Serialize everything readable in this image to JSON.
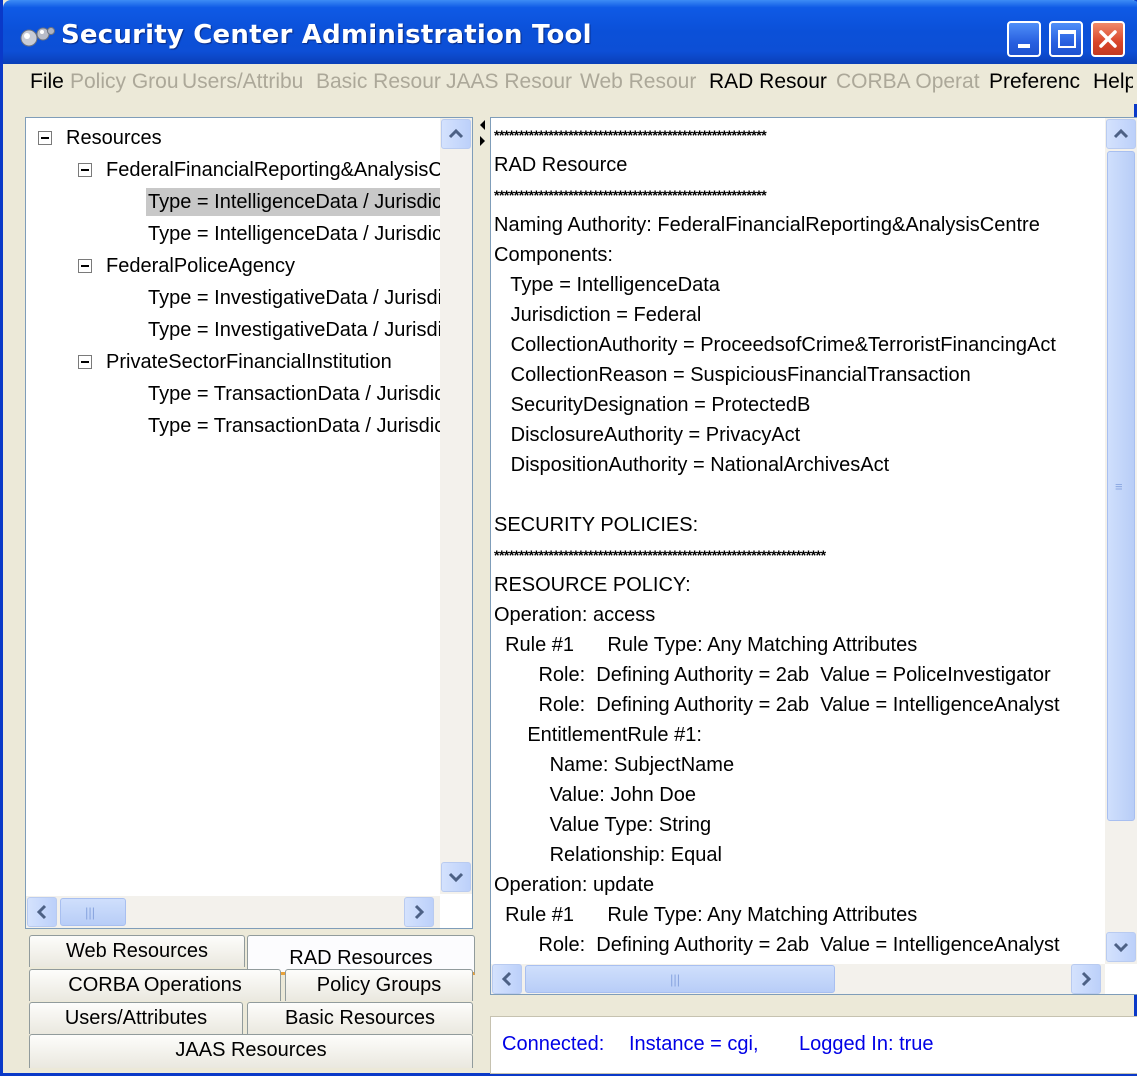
{
  "window": {
    "title": "Security Center Administration Tool"
  },
  "menubar": {
    "items": [
      {
        "label": "File",
        "enabled": true
      },
      {
        "label": "Policy Grou",
        "enabled": false
      },
      {
        "label": "Users/Attribu",
        "enabled": false
      },
      {
        "label": "Basic Resour",
        "enabled": false
      },
      {
        "label": "JAAS Resour",
        "enabled": false
      },
      {
        "label": "Web Resour",
        "enabled": false
      },
      {
        "label": "RAD Resour",
        "enabled": true
      },
      {
        "label": "CORBA Operat",
        "enabled": false
      },
      {
        "label": "Preferenc",
        "enabled": true
      },
      {
        "label": "Help",
        "enabled": true
      }
    ]
  },
  "tree": {
    "root": "Resources",
    "groups": [
      {
        "label": "FederalFinancialReporting&AnalysisCentre",
        "children": [
          {
            "label": "Type = IntelligenceData   /   Jurisdiction = Federal",
            "selected": true
          },
          {
            "label": "Type = IntelligenceData   /   Jurisdiction = Federal",
            "selected": false
          }
        ]
      },
      {
        "label": "FederalPoliceAgency",
        "children": [
          {
            "label": "Type = InvestigativeData   /   Jurisdiction = Federal",
            "selected": false
          },
          {
            "label": "Type = InvestigativeData   /   Jurisdiction = Federal",
            "selected": false
          }
        ]
      },
      {
        "label": "PrivateSectorFinancialInstitution",
        "children": [
          {
            "label": "Type = TransactionData   /   Jurisdiction = Federal",
            "selected": false
          },
          {
            "label": "Type = TransactionData   /   Jurisdiction = Federal",
            "selected": false
          }
        ]
      }
    ]
  },
  "tabs": {
    "web_resources": "Web Resources",
    "rad_resources": "RAD Resources",
    "corba_operations": "CORBA Operations",
    "policy_groups": "Policy Groups",
    "users_attributes": "Users/Attributes",
    "basic_resources": "Basic Resources",
    "jaas_resources": "JAAS Resources",
    "active": "RAD Resources"
  },
  "details": {
    "lines": [
      {
        "text": "*******************************************************",
        "stars": true
      },
      {
        "text": "RAD Resource"
      },
      {
        "text": "*******************************************************",
        "stars": true
      },
      {
        "text": "Naming Authority: FederalFinancialReporting&AnalysisCentre"
      },
      {
        "text": "Components:"
      },
      {
        "text": "   Type = IntelligenceData"
      },
      {
        "text": "   Jurisdiction = Federal"
      },
      {
        "text": "   CollectionAuthority = ProceedsofCrime&TerroristFinancingAct"
      },
      {
        "text": "   CollectionReason = SuspiciousFinancialTransaction"
      },
      {
        "text": "   SecurityDesignation = ProtectedB"
      },
      {
        "text": "   DisclosureAuthority = PrivacyAct"
      },
      {
        "text": "   DispositionAuthority = NationalArchivesAct"
      },
      {
        "text": ""
      },
      {
        "text": "SECURITY POLICIES:"
      },
      {
        "text": "*******************************************************************",
        "stars": true
      },
      {
        "text": "RESOURCE POLICY:"
      },
      {
        "text": "Operation: access"
      },
      {
        "text": "  Rule #1      Rule Type: Any Matching Attributes"
      },
      {
        "text": "        Role:  Defining Authority = 2ab  Value = PoliceInvestigator"
      },
      {
        "text": "        Role:  Defining Authority = 2ab  Value = IntelligenceAnalyst"
      },
      {
        "text": "      EntitlementRule #1:"
      },
      {
        "text": "          Name: SubjectName"
      },
      {
        "text": "          Value: John Doe"
      },
      {
        "text": "          Value Type: String"
      },
      {
        "text": "          Relationship: Equal"
      },
      {
        "text": "Operation: update"
      },
      {
        "text": "  Rule #1      Rule Type: Any Matching Attributes"
      },
      {
        "text": "        Role:  Defining Authority = 2ab  Value = IntelligenceAnalyst"
      }
    ]
  },
  "status": {
    "connected": "Connected:",
    "instance": "Instance = cgi,",
    "logged_in": "Logged In: true"
  },
  "colors": {
    "title_bar": "#0b50d8",
    "status_text": "#0000e6",
    "active_tab_accent": "#e9a23a",
    "selection": "#c8c8c8"
  }
}
